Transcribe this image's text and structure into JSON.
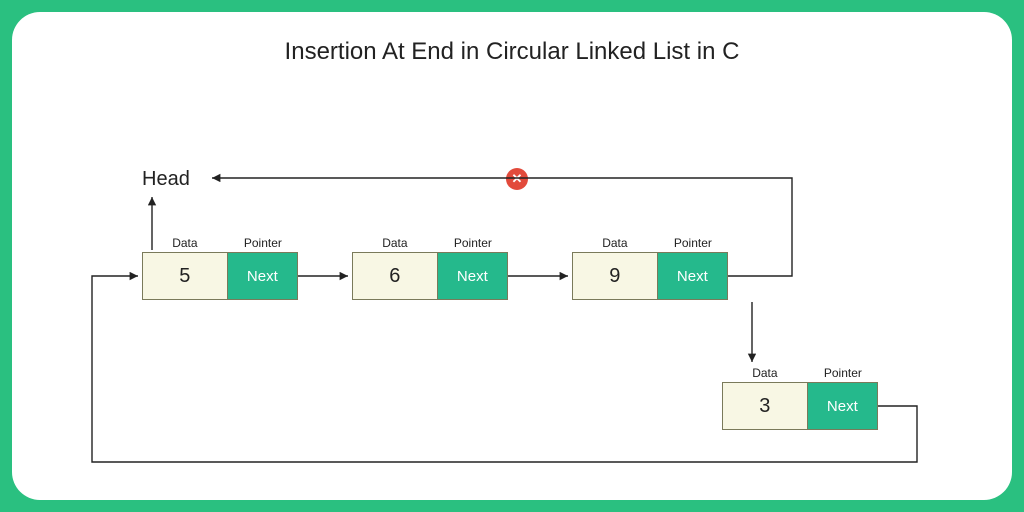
{
  "title": "Insertion At End in Circular Linked List in C",
  "head_label": "Head",
  "labels": {
    "data": "Data",
    "pointer": "Pointer",
    "next": "Next"
  },
  "nodes": {
    "n1": {
      "value": "5"
    },
    "n2": {
      "value": "6"
    },
    "n3": {
      "value": "9"
    },
    "n4": {
      "value": "3"
    }
  },
  "badge": {
    "icon": "✕"
  },
  "colors": {
    "frame": "#2ac080",
    "data_bg": "#f8f7e4",
    "pointer_bg": "#25b98c",
    "badge": "#e24a3b"
  }
}
